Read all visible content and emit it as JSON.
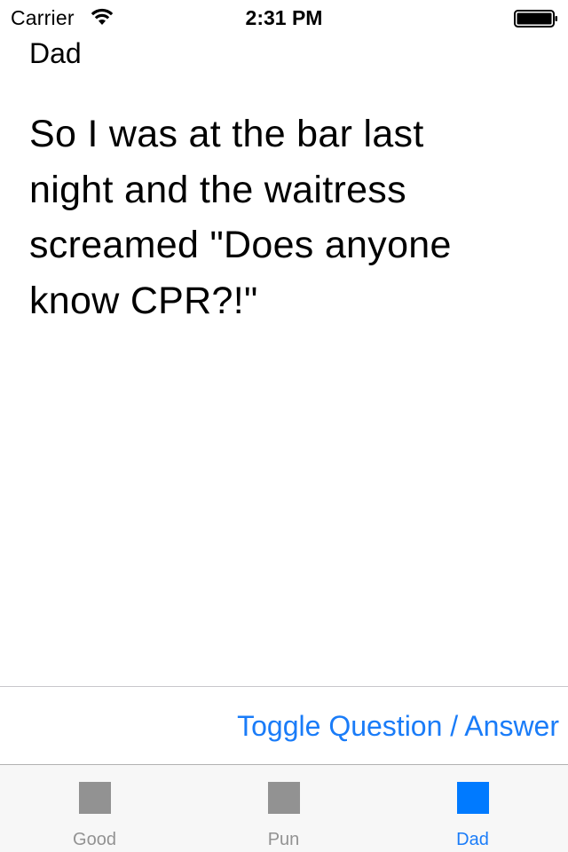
{
  "status_bar": {
    "carrier": "Carrier",
    "time": "2:31 PM"
  },
  "content": {
    "category": "Dad",
    "joke": "So I was at the bar last night and the waitress screamed \"Does anyone know CPR?!\""
  },
  "toggle": {
    "label": "Toggle Question / Answer"
  },
  "tab_bar": {
    "items": [
      {
        "label": "Good",
        "selected": false
      },
      {
        "label": "Pun",
        "selected": false
      },
      {
        "label": "Dad",
        "selected": true
      }
    ]
  },
  "colors": {
    "accent": "#007aff",
    "inactive": "#929292",
    "tab_bar_bg": "#f7f7f7"
  }
}
